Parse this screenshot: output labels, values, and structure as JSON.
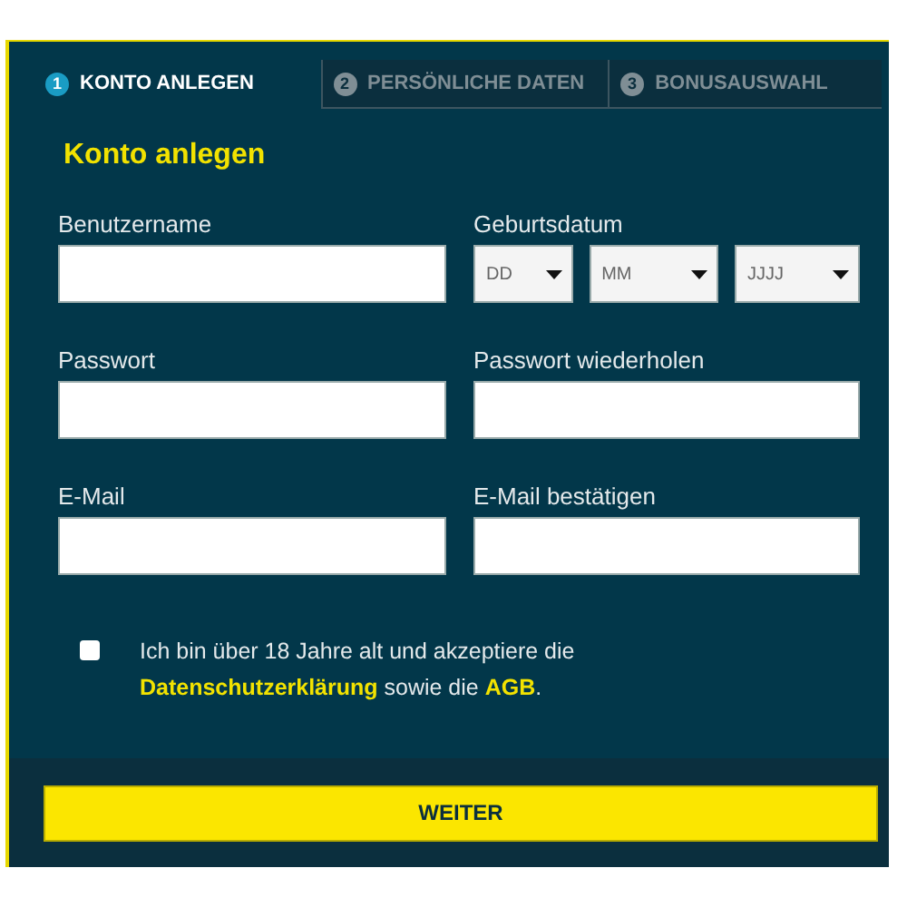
{
  "tabs": [
    {
      "number": "1",
      "label": "KONTO ANLEGEN",
      "selected": true
    },
    {
      "number": "2",
      "label": "PERSÖNLICHE DATEN",
      "selected": false
    },
    {
      "number": "3",
      "label": "BONUSAUSWAHL",
      "selected": false
    }
  ],
  "heading": "Konto anlegen",
  "fields": [
    {
      "kind": "text",
      "label": "Benutzername"
    },
    {
      "kind": "date",
      "label": "Geburtsdatum",
      "selects": [
        {
          "placeholder": "DD"
        },
        {
          "placeholder": "MM"
        },
        {
          "placeholder": "JJJJ"
        }
      ]
    },
    {
      "kind": "text",
      "label": "Passwort"
    },
    {
      "kind": "text",
      "label": "Passwort wiederholen"
    },
    {
      "kind": "text",
      "label": "E-Mail"
    },
    {
      "kind": "text",
      "label": "E-Mail bestätigen"
    }
  ],
  "consent": {
    "checked": false,
    "parts": [
      {
        "kind": "text",
        "text": "Ich bin über 18 Jahre alt und akzeptiere die "
      },
      {
        "kind": "link",
        "text": "Datenschutzerklärung"
      },
      {
        "kind": "text",
        "text": " sowie die "
      },
      {
        "kind": "link",
        "text": "AGB"
      },
      {
        "kind": "text",
        "text": "."
      }
    ]
  },
  "submit": "WEITER"
}
